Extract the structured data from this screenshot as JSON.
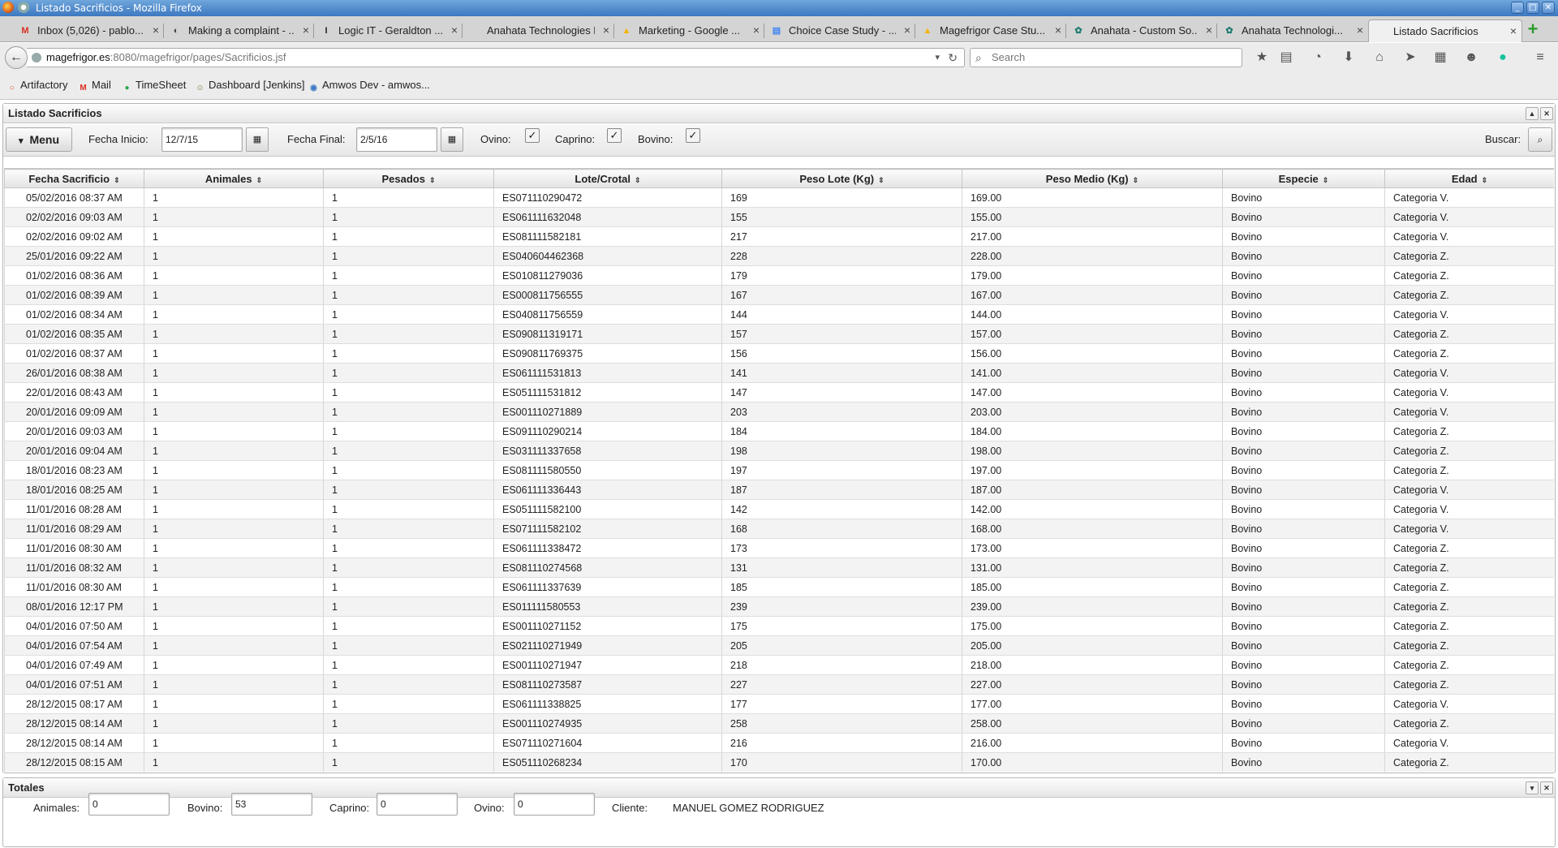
{
  "window": {
    "title": "Listado Sacrificios - Mozilla Firefox",
    "minimize": "_",
    "maximize": "□",
    "close": "✕"
  },
  "tabs": [
    {
      "title": "Inbox (5,026) - pablo...",
      "icon": "gmail-icon",
      "glyph": "M",
      "color": "#d93025"
    },
    {
      "title": "Making a complaint - ...",
      "icon": "page-icon",
      "glyph": "◐",
      "color": "#444"
    },
    {
      "title": "Logic IT - Geraldton ...",
      "icon": "logicit-icon",
      "glyph": "I",
      "color": "#222"
    },
    {
      "title": "Anahata Technologies Pt...",
      "icon": "blank-icon",
      "glyph": "",
      "color": "#222"
    },
    {
      "title": "Marketing - Google ...",
      "icon": "drive-icon",
      "glyph": "▲",
      "color": "#f4b400"
    },
    {
      "title": "Choice Case Study - ...",
      "icon": "docs-icon",
      "glyph": "▤",
      "color": "#4285f4"
    },
    {
      "title": "Magefrigor Case Stu...",
      "icon": "drive-icon",
      "glyph": "▲",
      "color": "#f4b400"
    },
    {
      "title": "Anahata - Custom So...",
      "icon": "anahata-icon",
      "glyph": "✿",
      "color": "#1a7a6e"
    },
    {
      "title": "Anahata Technologi...",
      "icon": "anahata-icon",
      "glyph": "✿",
      "color": "#1a7a6e"
    },
    {
      "title": "Listado Sacrificios",
      "icon": "blank-icon",
      "glyph": "",
      "color": "#222",
      "active": true
    }
  ],
  "newtab": "+",
  "nav": {
    "back": "←",
    "url_host": "magefrigor.es",
    "url_path": ":8080/magefrigor/pages/Sacrificios.jsf",
    "url_dropdown": "▾",
    "reload": "↻",
    "search_placeholder": "Search",
    "search_icon": "⌕",
    "icons": [
      "★",
      "▤",
      "◔",
      "⬇",
      "⌂",
      "➤",
      "▦",
      "☻",
      "●",
      "≡"
    ]
  },
  "bookmarks": [
    {
      "label": "Artifactory",
      "icon": "artifactory-icon",
      "glyph": "○",
      "color": "#e04a2a"
    },
    {
      "label": "Mail",
      "icon": "gmail-icon",
      "glyph": "M",
      "color": "#d93025"
    },
    {
      "label": "TimeSheet",
      "icon": "timesheet-icon",
      "glyph": "●",
      "color": "#2fa84f"
    },
    {
      "label": "Dashboard [Jenkins]",
      "icon": "jenkins-icon",
      "glyph": "☺",
      "color": "#8a6a4a"
    },
    {
      "label": "Amwos Dev - amwos...",
      "icon": "amwos-icon",
      "glyph": "◉",
      "color": "#3b78c4"
    }
  ],
  "panel": {
    "title": "Listado Sacrificios",
    "minimize": "▲",
    "close": "✕",
    "menu_label": "Menu",
    "menu_caret": "▾",
    "fecha_inicio_label": "Fecha Inicio:",
    "fecha_inicio": "12/7/15",
    "fecha_final_label": "Fecha Final:",
    "fecha_final": "2/5/16",
    "calendar_glyph": "▦",
    "ovino_label": "Ovino:",
    "caprino_label": "Caprino:",
    "bovino_label": "Bovino:",
    "check_glyph": "✓",
    "buscar_label": "Buscar:",
    "buscar_glyph": "⌕"
  },
  "table": {
    "sort_glyph": "⇕",
    "columns": [
      "Fecha Sacrificio",
      "Animales",
      "Pesados",
      "Lote/Crotal",
      "Peso Lote (Kg)",
      "Peso Medio (Kg)",
      "Especie",
      "Edad"
    ],
    "rows": [
      [
        "05/02/2016 08:37 AM",
        "1",
        "1",
        "ES071110290472",
        "169",
        "169.00",
        "Bovino",
        "Categoria V."
      ],
      [
        "02/02/2016 09:03 AM",
        "1",
        "1",
        "ES061111632048",
        "155",
        "155.00",
        "Bovino",
        "Categoria V."
      ],
      [
        "02/02/2016 09:02 AM",
        "1",
        "1",
        "ES081111582181",
        "217",
        "217.00",
        "Bovino",
        "Categoria V."
      ],
      [
        "25/01/2016 09:22 AM",
        "1",
        "1",
        "ES040604462368",
        "228",
        "228.00",
        "Bovino",
        "Categoria Z."
      ],
      [
        "01/02/2016 08:36 AM",
        "1",
        "1",
        "ES010811279036",
        "179",
        "179.00",
        "Bovino",
        "Categoria Z."
      ],
      [
        "01/02/2016 08:39 AM",
        "1",
        "1",
        "ES000811756555",
        "167",
        "167.00",
        "Bovino",
        "Categoria Z."
      ],
      [
        "01/02/2016 08:34 AM",
        "1",
        "1",
        "ES040811756559",
        "144",
        "144.00",
        "Bovino",
        "Categoria V."
      ],
      [
        "01/02/2016 08:35 AM",
        "1",
        "1",
        "ES090811319171",
        "157",
        "157.00",
        "Bovino",
        "Categoria Z."
      ],
      [
        "01/02/2016 08:37 AM",
        "1",
        "1",
        "ES090811769375",
        "156",
        "156.00",
        "Bovino",
        "Categoria Z."
      ],
      [
        "26/01/2016 08:38 AM",
        "1",
        "1",
        "ES061111531813",
        "141",
        "141.00",
        "Bovino",
        "Categoria V."
      ],
      [
        "22/01/2016 08:43 AM",
        "1",
        "1",
        "ES051111531812",
        "147",
        "147.00",
        "Bovino",
        "Categoria V."
      ],
      [
        "20/01/2016 09:09 AM",
        "1",
        "1",
        "ES001110271889",
        "203",
        "203.00",
        "Bovino",
        "Categoria V."
      ],
      [
        "20/01/2016 09:03 AM",
        "1",
        "1",
        "ES091110290214",
        "184",
        "184.00",
        "Bovino",
        "Categoria Z."
      ],
      [
        "20/01/2016 09:04 AM",
        "1",
        "1",
        "ES031111337658",
        "198",
        "198.00",
        "Bovino",
        "Categoria Z."
      ],
      [
        "18/01/2016 08:23 AM",
        "1",
        "1",
        "ES081111580550",
        "197",
        "197.00",
        "Bovino",
        "Categoria Z."
      ],
      [
        "18/01/2016 08:25 AM",
        "1",
        "1",
        "ES061111336443",
        "187",
        "187.00",
        "Bovino",
        "Categoria V."
      ],
      [
        "11/01/2016 08:28 AM",
        "1",
        "1",
        "ES051111582100",
        "142",
        "142.00",
        "Bovino",
        "Categoria V."
      ],
      [
        "11/01/2016 08:29 AM",
        "1",
        "1",
        "ES071111582102",
        "168",
        "168.00",
        "Bovino",
        "Categoria V."
      ],
      [
        "11/01/2016 08:30 AM",
        "1",
        "1",
        "ES061111338472",
        "173",
        "173.00",
        "Bovino",
        "Categoria Z."
      ],
      [
        "11/01/2016 08:32 AM",
        "1",
        "1",
        "ES081110274568",
        "131",
        "131.00",
        "Bovino",
        "Categoria Z."
      ],
      [
        "11/01/2016 08:30 AM",
        "1",
        "1",
        "ES061111337639",
        "185",
        "185.00",
        "Bovino",
        "Categoria Z."
      ],
      [
        "08/01/2016 12:17 PM",
        "1",
        "1",
        "ES011111580553",
        "239",
        "239.00",
        "Bovino",
        "Categoria Z."
      ],
      [
        "04/01/2016 07:50 AM",
        "1",
        "1",
        "ES001110271152",
        "175",
        "175.00",
        "Bovino",
        "Categoria Z."
      ],
      [
        "04/01/2016 07:54 AM",
        "1",
        "1",
        "ES021110271949",
        "205",
        "205.00",
        "Bovino",
        "Categoria Z."
      ],
      [
        "04/01/2016 07:49 AM",
        "1",
        "1",
        "ES001110271947",
        "218",
        "218.00",
        "Bovino",
        "Categoria Z."
      ],
      [
        "04/01/2016 07:51 AM",
        "1",
        "1",
        "ES081110273587",
        "227",
        "227.00",
        "Bovino",
        "Categoria Z."
      ],
      [
        "28/12/2015 08:17 AM",
        "1",
        "1",
        "ES061111338825",
        "177",
        "177.00",
        "Bovino",
        "Categoria V."
      ],
      [
        "28/12/2015 08:14 AM",
        "1",
        "1",
        "ES001110274935",
        "258",
        "258.00",
        "Bovino",
        "Categoria Z."
      ],
      [
        "28/12/2015 08:14 AM",
        "1",
        "1",
        "ES071110271604",
        "216",
        "216.00",
        "Bovino",
        "Categoria V."
      ],
      [
        "28/12/2015 08:15 AM",
        "1",
        "1",
        "ES051110268234",
        "170",
        "170.00",
        "Bovino",
        "Categoria Z."
      ]
    ]
  },
  "totales": {
    "title": "Totales",
    "toggle": "▾",
    "close": "✕",
    "animales_label": "Animales:",
    "animales": "0",
    "bovino_label": "Bovino:",
    "bovino": "53",
    "caprino_label": "Caprino:",
    "caprino": "0",
    "ovino_label": "Ovino:",
    "ovino": "0",
    "cliente_label": "Cliente:",
    "cliente": "MANUEL GOMEZ RODRIGUEZ"
  }
}
